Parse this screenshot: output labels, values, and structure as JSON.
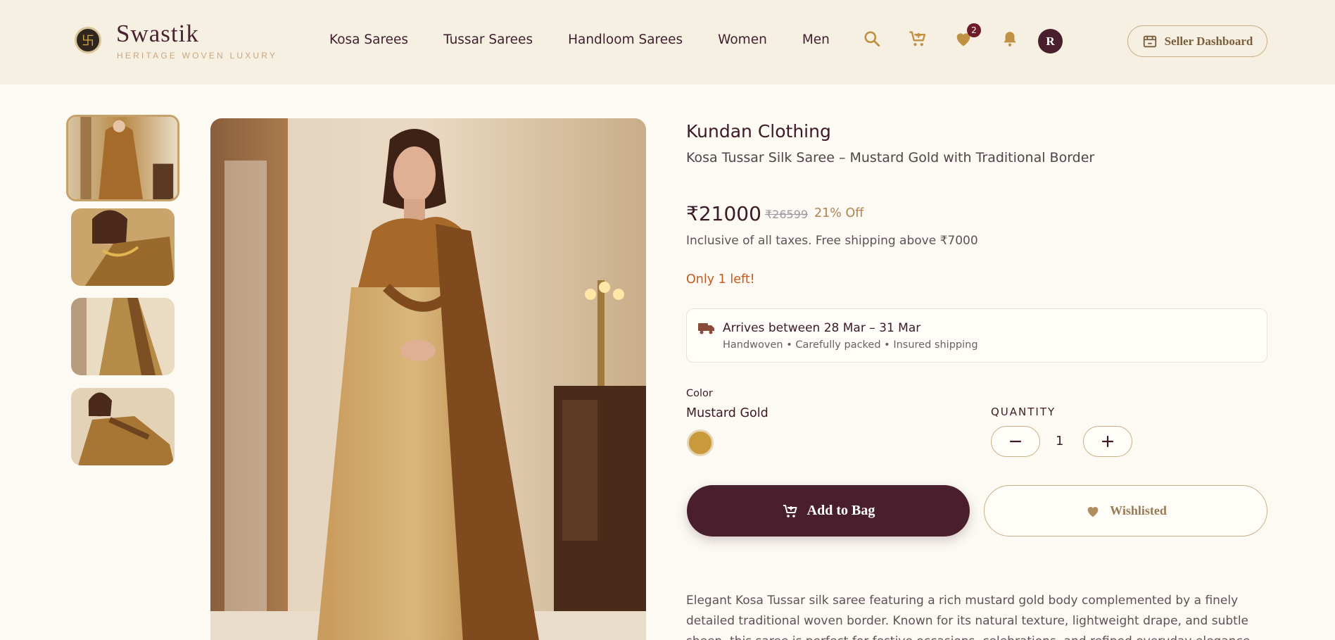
{
  "header": {
    "logo_glyph": "卐",
    "brand_name": "Swastik",
    "brand_tagline": "HERITAGE WOVEN LUXURY",
    "nav": [
      "Kosa Sarees",
      "Tussar Sarees",
      "Handloom Sarees",
      "Women",
      "Men"
    ],
    "icons": [
      "search-icon",
      "cart-icon",
      "heart-icon",
      "bell-icon"
    ],
    "wishlist_count": "2",
    "avatar_initial": "R",
    "seller_label": "Seller Dashboard"
  },
  "product": {
    "brand": "Kundan Clothing",
    "name": "Kosa Tussar Silk Saree – Mustard Gold with Traditional Border",
    "price": "₹21000",
    "mrp": "₹26599",
    "discount": "21% Off",
    "tax_note": "Inclusive of all taxes. Free shipping above ₹7000",
    "stock": "Only 1 left!",
    "delivery_title": "Arrives between 28 Mar – 31 Mar",
    "delivery_sub": "Handwoven • Carefully packed • Insured shipping",
    "color_label": "Color",
    "color_value": "Mustard Gold",
    "color_hex": "#c99a3c",
    "quantity_label": "QUANTITY",
    "quantity": "1",
    "add_to_bag": "Add to Bag",
    "wishlist_label": "Wishlisted",
    "description": "Elegant Kosa Tussar silk saree featuring a rich mustard gold body complemented by a finely detailed traditional woven border. Known for its natural texture, lightweight drape, and subtle sheen, this saree is perfect for festive occasions, celebrations, and refined everyday elegance."
  },
  "colors": {
    "accent": "#4a1f2d",
    "gold": "#c5a06a",
    "warning": "#c65a1c"
  }
}
